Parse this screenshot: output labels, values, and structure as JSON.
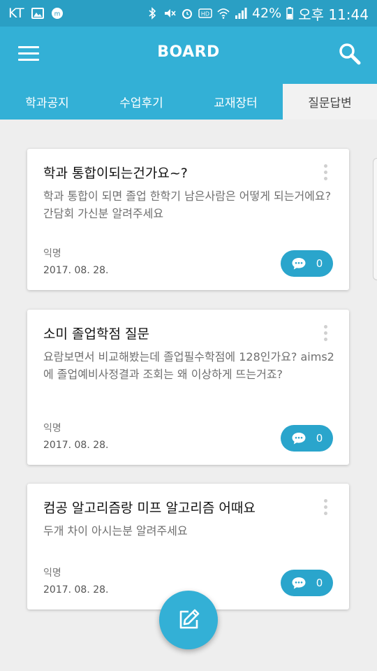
{
  "status_bar": {
    "carrier": "KT",
    "battery": "42%",
    "time": "오후 11:44"
  },
  "app_bar": {
    "title": "BOARD",
    "menu_icon": "hamburger-menu-icon",
    "search_icon": "search-icon"
  },
  "tabs": [
    {
      "label": "학과공지",
      "active": false
    },
    {
      "label": "수업후기",
      "active": false
    },
    {
      "label": "교재장터",
      "active": false
    },
    {
      "label": "질문답변",
      "active": true
    }
  ],
  "posts": [
    {
      "title": "학과 통합이되는건가요~?",
      "body": "학과 통합이 되면 졸업 한학기 남은사람은 어떻게 되는거에요? 간담회 가신분 알려주세요",
      "author": "익명",
      "date": "2017. 08. 28.",
      "comments": "0"
    },
    {
      "title": "소미 졸업학점 질문",
      "body": "요람보면서 비교해봤는데 졸업필수학점에 128인가요? aims2에 졸업예비사정결과 조회는 왜 이상하게 뜨는거죠?",
      "author": "익명",
      "date": "2017. 08. 28.",
      "comments": "0"
    },
    {
      "title": "컴공 알고리즘랑 미프 알고리즘 어때요",
      "body": "두개 차이 아시는분 알려주세요",
      "author": "익명",
      "date": "2017. 08. 28.",
      "comments": "0"
    }
  ],
  "fab_icon": "edit-pencil-icon",
  "colors": {
    "primary": "#33b0d6",
    "status_bar": "#2a9fc4",
    "comment_pill": "#2aa5cc",
    "background": "#eeeeee"
  }
}
